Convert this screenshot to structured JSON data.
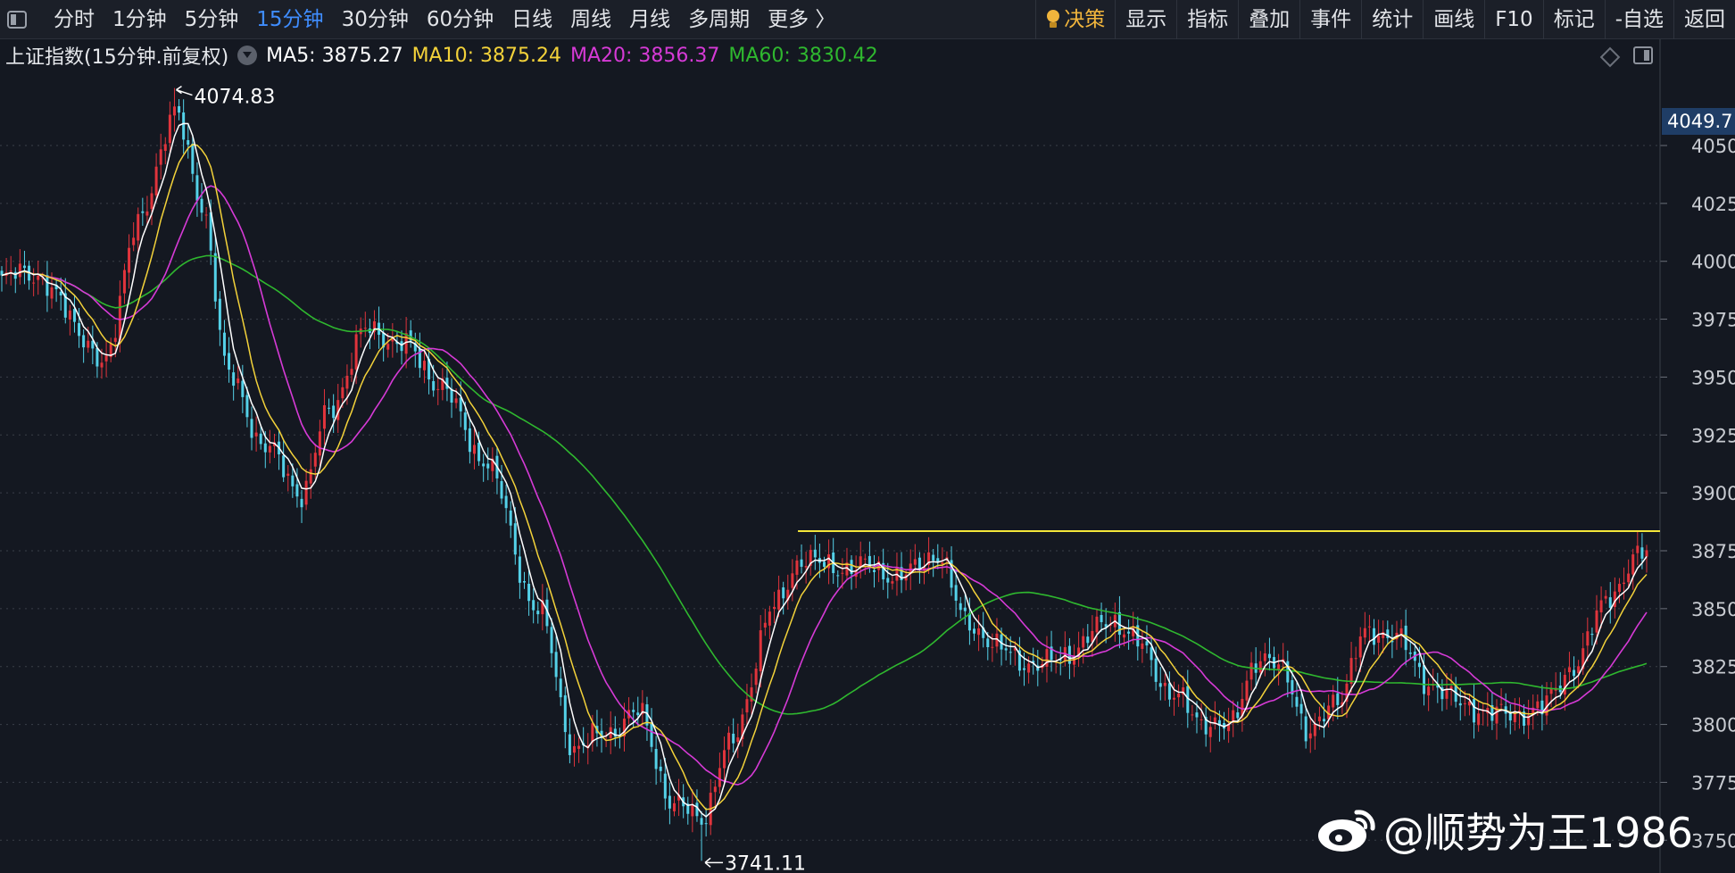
{
  "toolbar": {
    "periods": [
      {
        "label": "分时"
      },
      {
        "label": "1分钟"
      },
      {
        "label": "5分钟"
      },
      {
        "label": "15分钟"
      },
      {
        "label": "30分钟"
      },
      {
        "label": "60分钟"
      },
      {
        "label": "日线"
      },
      {
        "label": "周线"
      },
      {
        "label": "月线"
      },
      {
        "label": "多周期"
      },
      {
        "label": "更多 〉"
      }
    ],
    "active_period": "15分钟",
    "tools": [
      {
        "label": "决策"
      },
      {
        "label": "显示"
      },
      {
        "label": "指标"
      },
      {
        "label": "叠加"
      },
      {
        "label": "事件"
      },
      {
        "label": "统计"
      },
      {
        "label": "画线"
      },
      {
        "label": "F10"
      },
      {
        "label": "标记"
      },
      {
        "label": "-自选"
      },
      {
        "label": "返回"
      }
    ]
  },
  "info": {
    "title": "上证指数(15分钟.前复权)",
    "ma5": "MA5: 3875.27",
    "ma10": "MA10: 3875.24",
    "ma20": "MA20: 3856.37",
    "ma60": "MA60: 3830.42"
  },
  "colors": {
    "background": "#141821",
    "up": "#e0343c",
    "down": "#54d1e8",
    "ma5": "#ffffff",
    "ma10": "#f3d23a",
    "ma20": "#d63ad6",
    "ma60": "#2fb82f",
    "resistance": "#f3e63a",
    "active_tab": "#3f8dff"
  },
  "current_price_tag": "4049.7",
  "watermark": "@顺势为王1986",
  "chart_data": {
    "type": "candlestick",
    "ylim": [
      3737,
      4082
    ],
    "y_ticks": [
      {
        "value": 4050,
        "label": "4050"
      },
      {
        "value": 4025,
        "label": "4025"
      },
      {
        "value": 4000,
        "label": "4000"
      },
      {
        "value": 3975,
        "label": "3975"
      },
      {
        "value": 3950,
        "label": "3950"
      },
      {
        "value": 3925,
        "label": "3925"
      },
      {
        "value": 3900,
        "label": "3900"
      },
      {
        "value": 3875,
        "label": "3875"
      },
      {
        "value": 3850,
        "label": "3850"
      },
      {
        "value": 3825,
        "label": "3825"
      },
      {
        "value": 3800,
        "label": "3800"
      },
      {
        "value": 3775,
        "label": "3775"
      },
      {
        "value": 3750,
        "label": "3750"
      }
    ],
    "annotations": {
      "high": {
        "value": 4074.83,
        "label": "4074.83"
      },
      "low": {
        "value": 3741.11,
        "label": "3741.11"
      }
    },
    "resistance_level": 3883.5,
    "close_anchors": [
      [
        0,
        3990
      ],
      [
        4,
        3998
      ],
      [
        12,
        3985
      ],
      [
        22,
        3955
      ],
      [
        30,
        4015
      ],
      [
        38,
        4065
      ],
      [
        44,
        4025
      ],
      [
        50,
        3950
      ],
      [
        58,
        3920
      ],
      [
        66,
        3900
      ],
      [
        72,
        3935
      ],
      [
        80,
        3970
      ],
      [
        88,
        3965
      ],
      [
        96,
        3948
      ],
      [
        106,
        3915
      ],
      [
        118,
        3850
      ],
      [
        126,
        3790
      ],
      [
        132,
        3795
      ],
      [
        140,
        3805
      ],
      [
        148,
        3765
      ],
      [
        154,
        3760
      ],
      [
        160,
        3790
      ],
      [
        170,
        3850
      ],
      [
        176,
        3872
      ],
      [
        182,
        3868
      ],
      [
        190,
        3868
      ],
      [
        198,
        3864
      ],
      [
        206,
        3874
      ],
      [
        212,
        3845
      ],
      [
        220,
        3832
      ],
      [
        228,
        3825
      ],
      [
        236,
        3832
      ],
      [
        244,
        3846
      ],
      [
        250,
        3835
      ],
      [
        258,
        3812
      ],
      [
        264,
        3802
      ],
      [
        270,
        3798
      ],
      [
        276,
        3828
      ],
      [
        282,
        3824
      ],
      [
        288,
        3795
      ],
      [
        294,
        3812
      ],
      [
        300,
        3838
      ],
      [
        306,
        3840
      ],
      [
        314,
        3818
      ],
      [
        322,
        3808
      ],
      [
        330,
        3804
      ],
      [
        338,
        3806
      ],
      [
        346,
        3825
      ],
      [
        354,
        3857
      ],
      [
        362,
        3875
      ]
    ],
    "candle_count": 363
  }
}
